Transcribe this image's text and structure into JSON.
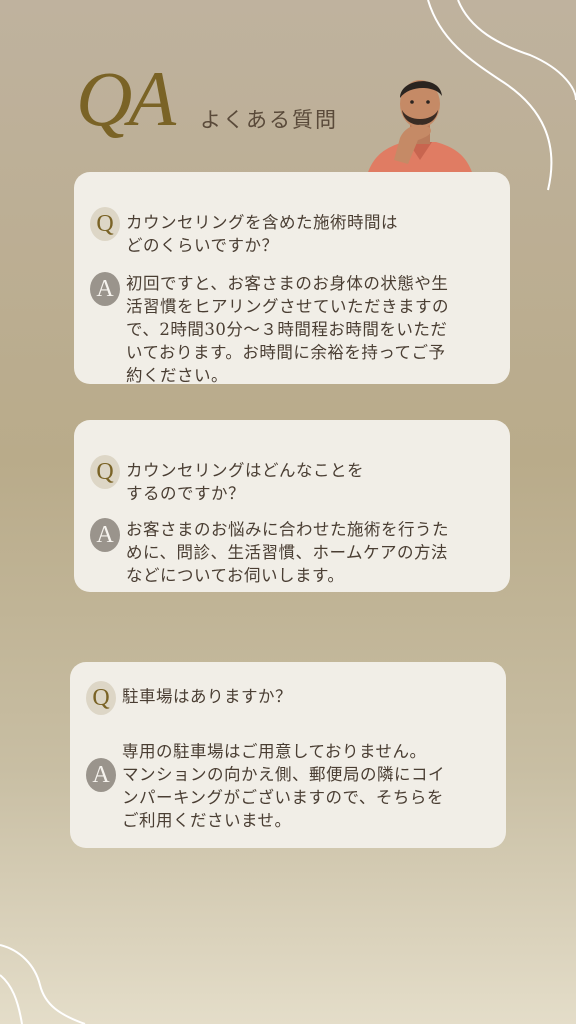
{
  "header": {
    "title_qa": "QA",
    "subtitle": "よくある質問"
  },
  "faq": [
    {
      "q_mark": "Q",
      "question": "カウンセリングを含めた施術時間は\nどのくらいですか？",
      "a_mark": "A",
      "answer": "初回ですと、お客さまのお身体の状態や生\n活習慣をヒアリングさせていただきますの\nで、2時間30分〜３時間程お時間をいただ\nいております。お時間に余裕を持ってご予\n約ください。"
    },
    {
      "q_mark": "Q",
      "question": "カウンセリングはどんなことを\nするのですか？",
      "a_mark": "A",
      "answer": "お客さまのお悩みに合わせた施術を行うた\nめに、問診、生活習慣、ホームケアの方法\nなどについてお伺いします。"
    },
    {
      "q_mark": "Q",
      "question": "駐車場はありますか？",
      "a_mark": "A",
      "answer": "専用の駐車場はご用意しておりません。\nマンションの向かえ側、郵便局の隣にコイ\nンパーキングがございますので、そちらを\nご利用くださいませ。"
    }
  ],
  "colors": {
    "accent": "#7a6326",
    "card": "#f1eee7",
    "text": "#4a3e33",
    "a_badge": "#9a948c"
  },
  "icons": {
    "illustration": "thinking-man-icon",
    "decoration": "white-line-swirl"
  }
}
